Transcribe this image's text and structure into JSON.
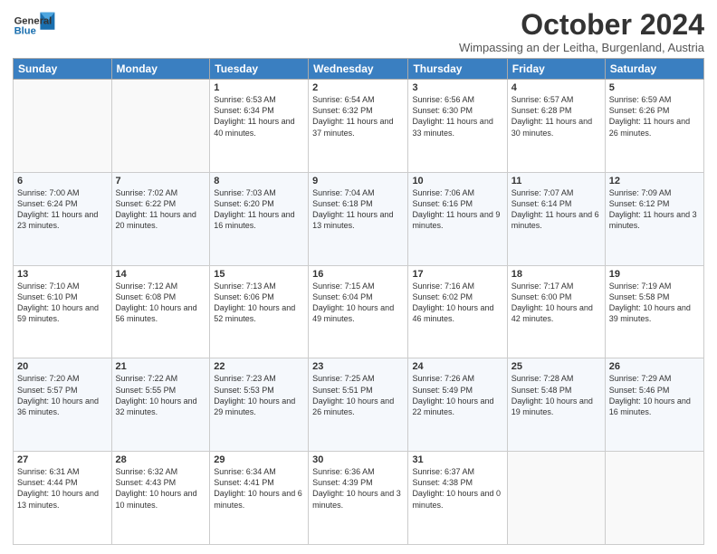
{
  "header": {
    "logo_general": "General",
    "logo_blue": "Blue",
    "month": "October 2024",
    "location": "Wimpassing an der Leitha, Burgenland, Austria"
  },
  "weekdays": [
    "Sunday",
    "Monday",
    "Tuesday",
    "Wednesday",
    "Thursday",
    "Friday",
    "Saturday"
  ],
  "weeks": [
    [
      {
        "day": "",
        "info": ""
      },
      {
        "day": "",
        "info": ""
      },
      {
        "day": "1",
        "info": "Sunrise: 6:53 AM\nSunset: 6:34 PM\nDaylight: 11 hours and 40 minutes."
      },
      {
        "day": "2",
        "info": "Sunrise: 6:54 AM\nSunset: 6:32 PM\nDaylight: 11 hours and 37 minutes."
      },
      {
        "day": "3",
        "info": "Sunrise: 6:56 AM\nSunset: 6:30 PM\nDaylight: 11 hours and 33 minutes."
      },
      {
        "day": "4",
        "info": "Sunrise: 6:57 AM\nSunset: 6:28 PM\nDaylight: 11 hours and 30 minutes."
      },
      {
        "day": "5",
        "info": "Sunrise: 6:59 AM\nSunset: 6:26 PM\nDaylight: 11 hours and 26 minutes."
      }
    ],
    [
      {
        "day": "6",
        "info": "Sunrise: 7:00 AM\nSunset: 6:24 PM\nDaylight: 11 hours and 23 minutes."
      },
      {
        "day": "7",
        "info": "Sunrise: 7:02 AM\nSunset: 6:22 PM\nDaylight: 11 hours and 20 minutes."
      },
      {
        "day": "8",
        "info": "Sunrise: 7:03 AM\nSunset: 6:20 PM\nDaylight: 11 hours and 16 minutes."
      },
      {
        "day": "9",
        "info": "Sunrise: 7:04 AM\nSunset: 6:18 PM\nDaylight: 11 hours and 13 minutes."
      },
      {
        "day": "10",
        "info": "Sunrise: 7:06 AM\nSunset: 6:16 PM\nDaylight: 11 hours and 9 minutes."
      },
      {
        "day": "11",
        "info": "Sunrise: 7:07 AM\nSunset: 6:14 PM\nDaylight: 11 hours and 6 minutes."
      },
      {
        "day": "12",
        "info": "Sunrise: 7:09 AM\nSunset: 6:12 PM\nDaylight: 11 hours and 3 minutes."
      }
    ],
    [
      {
        "day": "13",
        "info": "Sunrise: 7:10 AM\nSunset: 6:10 PM\nDaylight: 10 hours and 59 minutes."
      },
      {
        "day": "14",
        "info": "Sunrise: 7:12 AM\nSunset: 6:08 PM\nDaylight: 10 hours and 56 minutes."
      },
      {
        "day": "15",
        "info": "Sunrise: 7:13 AM\nSunset: 6:06 PM\nDaylight: 10 hours and 52 minutes."
      },
      {
        "day": "16",
        "info": "Sunrise: 7:15 AM\nSunset: 6:04 PM\nDaylight: 10 hours and 49 minutes."
      },
      {
        "day": "17",
        "info": "Sunrise: 7:16 AM\nSunset: 6:02 PM\nDaylight: 10 hours and 46 minutes."
      },
      {
        "day": "18",
        "info": "Sunrise: 7:17 AM\nSunset: 6:00 PM\nDaylight: 10 hours and 42 minutes."
      },
      {
        "day": "19",
        "info": "Sunrise: 7:19 AM\nSunset: 5:58 PM\nDaylight: 10 hours and 39 minutes."
      }
    ],
    [
      {
        "day": "20",
        "info": "Sunrise: 7:20 AM\nSunset: 5:57 PM\nDaylight: 10 hours and 36 minutes."
      },
      {
        "day": "21",
        "info": "Sunrise: 7:22 AM\nSunset: 5:55 PM\nDaylight: 10 hours and 32 minutes."
      },
      {
        "day": "22",
        "info": "Sunrise: 7:23 AM\nSunset: 5:53 PM\nDaylight: 10 hours and 29 minutes."
      },
      {
        "day": "23",
        "info": "Sunrise: 7:25 AM\nSunset: 5:51 PM\nDaylight: 10 hours and 26 minutes."
      },
      {
        "day": "24",
        "info": "Sunrise: 7:26 AM\nSunset: 5:49 PM\nDaylight: 10 hours and 22 minutes."
      },
      {
        "day": "25",
        "info": "Sunrise: 7:28 AM\nSunset: 5:48 PM\nDaylight: 10 hours and 19 minutes."
      },
      {
        "day": "26",
        "info": "Sunrise: 7:29 AM\nSunset: 5:46 PM\nDaylight: 10 hours and 16 minutes."
      }
    ],
    [
      {
        "day": "27",
        "info": "Sunrise: 6:31 AM\nSunset: 4:44 PM\nDaylight: 10 hours and 13 minutes."
      },
      {
        "day": "28",
        "info": "Sunrise: 6:32 AM\nSunset: 4:43 PM\nDaylight: 10 hours and 10 minutes."
      },
      {
        "day": "29",
        "info": "Sunrise: 6:34 AM\nSunset: 4:41 PM\nDaylight: 10 hours and 6 minutes."
      },
      {
        "day": "30",
        "info": "Sunrise: 6:36 AM\nSunset: 4:39 PM\nDaylight: 10 hours and 3 minutes."
      },
      {
        "day": "31",
        "info": "Sunrise: 6:37 AM\nSunset: 4:38 PM\nDaylight: 10 hours and 0 minutes."
      },
      {
        "day": "",
        "info": ""
      },
      {
        "day": "",
        "info": ""
      }
    ]
  ]
}
